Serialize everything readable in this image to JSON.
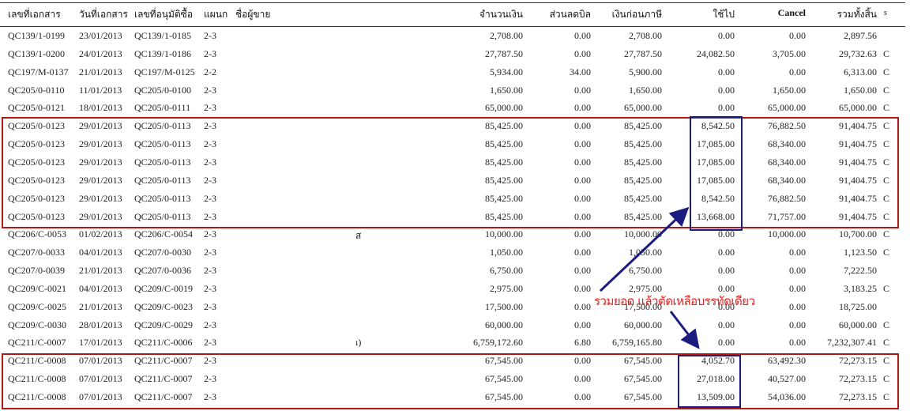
{
  "headers": {
    "doc_no": "เลขที่เอกสาร",
    "doc_date": "วันที่เอกสาร",
    "approve_no": "เลขที่อนุมัติซื้อ",
    "dept": "แผนก",
    "vendor": "ชื่อผู้ขาย",
    "amount": "จำนวนเงิน",
    "discount": "ส่วนลดบิล",
    "pretax": "เงินก่อนภาษี",
    "used": "ใช้ไป",
    "cancel": "Cancel",
    "total": "รวมทั้งสิ้น",
    "s": "s"
  },
  "rows": [
    [
      "QC139/1-0199",
      "23/01/2013",
      "QC139/1-0185",
      "2-3",
      "",
      "2,708.00",
      "0.00",
      "2,708.00",
      "0.00",
      "0.00",
      "2,897.56",
      ""
    ],
    [
      "QC139/1-0200",
      "24/01/2013",
      "QC139/1-0186",
      "2-3",
      "",
      "27,787.50",
      "0.00",
      "27,787.50",
      "24,082.50",
      "3,705.00",
      "29,732.63",
      "C"
    ],
    [
      "QC197/M-0137",
      "21/01/2013",
      "QC197/M-0125",
      "2-2",
      "",
      "5,934.00",
      "34.00",
      "5,900.00",
      "0.00",
      "0.00",
      "6,313.00",
      "C"
    ],
    [
      "QC205/0-0110",
      "11/01/2013",
      "QC205/0-0100",
      "2-3",
      "",
      "1,650.00",
      "0.00",
      "1,650.00",
      "0.00",
      "1,650.00",
      "1,650.00",
      "C"
    ],
    [
      "QC205/0-0121",
      "18/01/2013",
      "QC205/0-0111",
      "2-3",
      "",
      "65,000.00",
      "0.00",
      "65,000.00",
      "0.00",
      "65,000.00",
      "65,000.00",
      "C"
    ],
    [
      "QC205/0-0123",
      "29/01/2013",
      "QC205/0-0113",
      "2-3",
      "",
      "85,425.00",
      "0.00",
      "85,425.00",
      "8,542.50",
      "76,882.50",
      "91,404.75",
      "C"
    ],
    [
      "QC205/0-0123",
      "29/01/2013",
      "QC205/0-0113",
      "2-3",
      "",
      "85,425.00",
      "0.00",
      "85,425.00",
      "17,085.00",
      "68,340.00",
      "91,404.75",
      "C"
    ],
    [
      "QC205/0-0123",
      "29/01/2013",
      "QC205/0-0113",
      "2-3",
      "",
      "85,425.00",
      "0.00",
      "85,425.00",
      "17,085.00",
      "68,340.00",
      "91,404.75",
      "C"
    ],
    [
      "QC205/0-0123",
      "29/01/2013",
      "QC205/0-0113",
      "2-3",
      "",
      "85,425.00",
      "0.00",
      "85,425.00",
      "17,085.00",
      "68,340.00",
      "91,404.75",
      "C"
    ],
    [
      "QC205/0-0123",
      "29/01/2013",
      "QC205/0-0113",
      "2-3",
      "",
      "85,425.00",
      "0.00",
      "85,425.00",
      "8,542.50",
      "76,882.50",
      "91,404.75",
      "C"
    ],
    [
      "QC205/0-0123",
      "29/01/2013",
      "QC205/0-0113",
      "2-3",
      "",
      "85,425.00",
      "0.00",
      "85,425.00",
      "13,668.00",
      "71,757.00",
      "91,404.75",
      "C"
    ],
    [
      "QC206/C-0053",
      "01/02/2013",
      "QC206/C-0054",
      "2-3",
      "ส",
      "10,000.00",
      "0.00",
      "10,000.00",
      "0.00",
      "10,000.00",
      "10,700.00",
      "C"
    ],
    [
      "QC207/0-0033",
      "04/01/2013",
      "QC207/0-0030",
      "2-3",
      "",
      "1,050.00",
      "0.00",
      "1,050.00",
      "0.00",
      "0.00",
      "1,123.50",
      "C"
    ],
    [
      "QC207/0-0039",
      "21/01/2013",
      "QC207/0-0036",
      "2-3",
      "",
      "6,750.00",
      "0.00",
      "6,750.00",
      "0.00",
      "0.00",
      "7,222.50",
      ""
    ],
    [
      "QC209/C-0021",
      "04/01/2013",
      "QC209/C-0019",
      "2-3",
      "",
      "2,975.00",
      "0.00",
      "2,975.00",
      "0.00",
      "0.00",
      "3,183.25",
      "C"
    ],
    [
      "QC209/C-0025",
      "21/01/2013",
      "QC209/C-0023",
      "2-3",
      "",
      "17,500.00",
      "0.00",
      "17,500.00",
      "0.00",
      "0.00",
      "18,725.00",
      ""
    ],
    [
      "QC209/C-0030",
      "28/01/2013",
      "QC209/C-0029",
      "2-3",
      "",
      "60,000.00",
      "0.00",
      "60,000.00",
      "0.00",
      "0.00",
      "60,000.00",
      "C"
    ],
    [
      "QC211/C-0007",
      "17/01/2013",
      "QC211/C-0006",
      "2-3",
      "ı)",
      "6,759,172.60",
      "6.80",
      "6,759,165.80",
      "0.00",
      "0.00",
      "7,232,307.41",
      "C"
    ],
    [
      "QC211/C-0008",
      "07/01/2013",
      "QC211/C-0007",
      "2-3",
      "",
      "67,545.00",
      "0.00",
      "67,545.00",
      "4,052.70",
      "63,492.30",
      "72,273.15",
      "C"
    ],
    [
      "QC211/C-0008",
      "07/01/2013",
      "QC211/C-0007",
      "2-3",
      "",
      "67,545.00",
      "0.00",
      "67,545.00",
      "27,018.00",
      "40,527.00",
      "72,273.15",
      "C"
    ],
    [
      "QC211/C-0008",
      "07/01/2013",
      "QC211/C-0007",
      "2-3",
      "",
      "67,545.00",
      "0.00",
      "67,545.00",
      "13,509.00",
      "54,036.00",
      "72,273.15",
      "C"
    ]
  ],
  "annotation": "รวมยอด แล้วตัดเหลือบรรทัดเดียว",
  "colors": {
    "highlight_box": "#b01818",
    "used_box": "#1c1c80",
    "annotation": "#e0201c",
    "arrow": "#1c1c80"
  }
}
